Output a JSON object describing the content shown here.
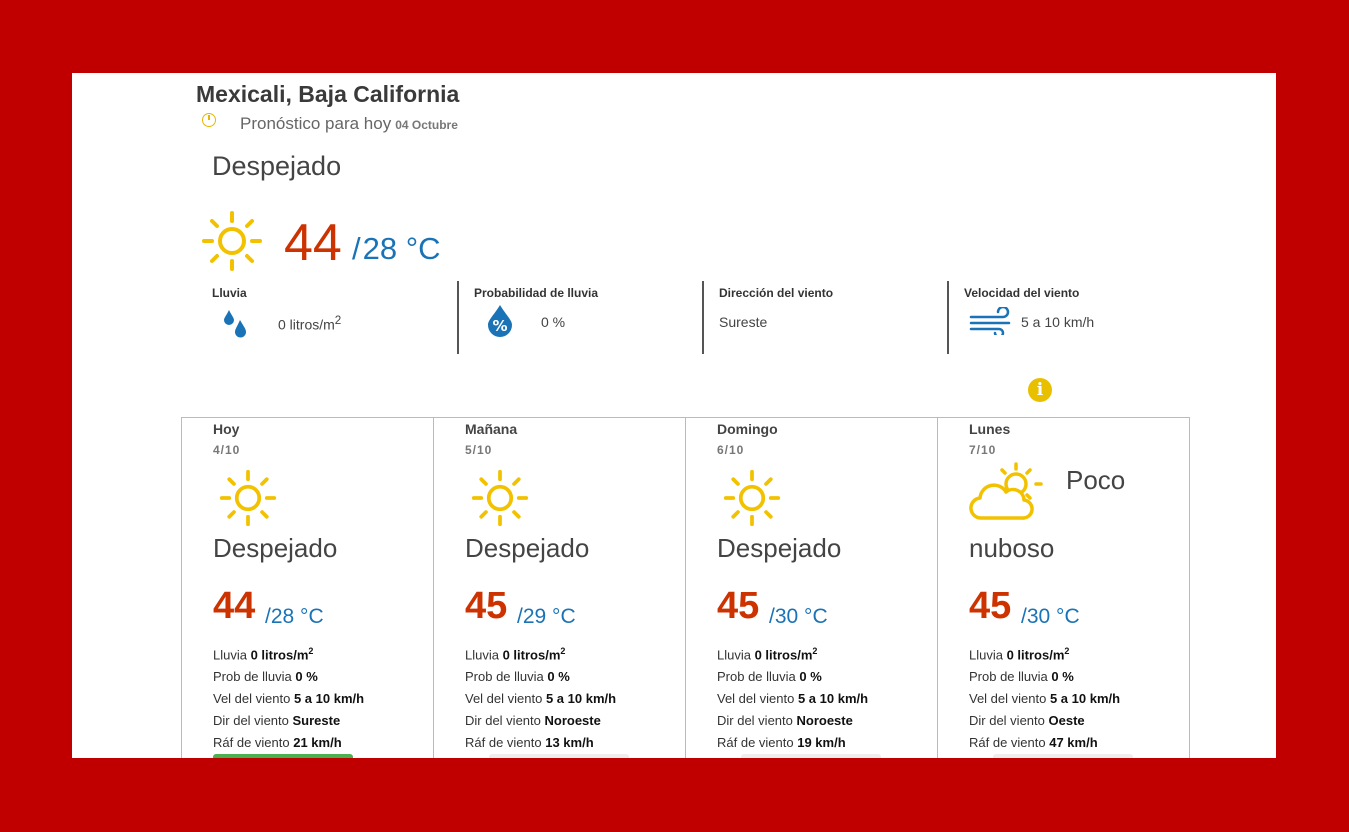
{
  "location": "Mexicali, Baja California",
  "forecast_label": "Pronóstico para hoy",
  "forecast_date": "04 Octubre",
  "today": {
    "condition": "Despejado",
    "max": "44",
    "min": "28",
    "unit": "°C"
  },
  "stats": [
    {
      "label": "Lluvia",
      "value": "0 litros/m",
      "sup": "2",
      "icon": "rain-drops-icon"
    },
    {
      "label": "Probabilidad de lluvia",
      "value": "0 %",
      "icon": "percent-drop-icon"
    },
    {
      "label": "Dirección del viento",
      "value": "Sureste"
    },
    {
      "label": "Velocidad del viento",
      "value": "5 a 10 km/h",
      "icon": "wind-icon"
    }
  ],
  "row_labels": {
    "rain": "Lluvia",
    "prob": "Prob de lluvia",
    "speed": "Vel del viento",
    "dir": "Dir del viento",
    "gust": "Ráf de viento"
  },
  "days": [
    {
      "day": "Hoy",
      "date": "4/10",
      "icon": "sun-icon",
      "condition": "Despejado",
      "max": "44",
      "min": "/28",
      "unit": "°C",
      "rain": "0 litros/m",
      "prob": "0 %",
      "speed": "5 a 10 km/h",
      "dir": "Sureste",
      "gust": "21 km/h"
    },
    {
      "day": "Mañana",
      "date": "5/10",
      "icon": "sun-icon",
      "condition": "Despejado",
      "max": "45",
      "min": "/29",
      "unit": "°C",
      "rain": "0 litros/m",
      "prob": "0 %",
      "speed": "5 a 10 km/h",
      "dir": "Noroeste",
      "gust": "13 km/h"
    },
    {
      "day": "Domingo",
      "date": "6/10",
      "icon": "sun-icon",
      "condition": "Despejado",
      "max": "45",
      "min": "/30",
      "unit": "°C",
      "rain": "0 litros/m",
      "prob": "0 %",
      "speed": "5 a 10 km/h",
      "dir": "Noroeste",
      "gust": "19 km/h"
    },
    {
      "day": "Lunes",
      "date": "7/10",
      "icon": "partly-cloudy-icon",
      "condition_a": "Poco",
      "condition_b": "nuboso",
      "max": "45",
      "min": "/30",
      "unit": "°C",
      "rain": "0 litros/m",
      "prob": "0 %",
      "speed": "5 a 10 km/h",
      "dir": "Oeste",
      "gust": "47 km/h"
    }
  ],
  "colors": {
    "frame": "#c00000",
    "max_temp": "#cc3300",
    "min_temp": "#1a73b6",
    "sun": "#f2c200"
  }
}
